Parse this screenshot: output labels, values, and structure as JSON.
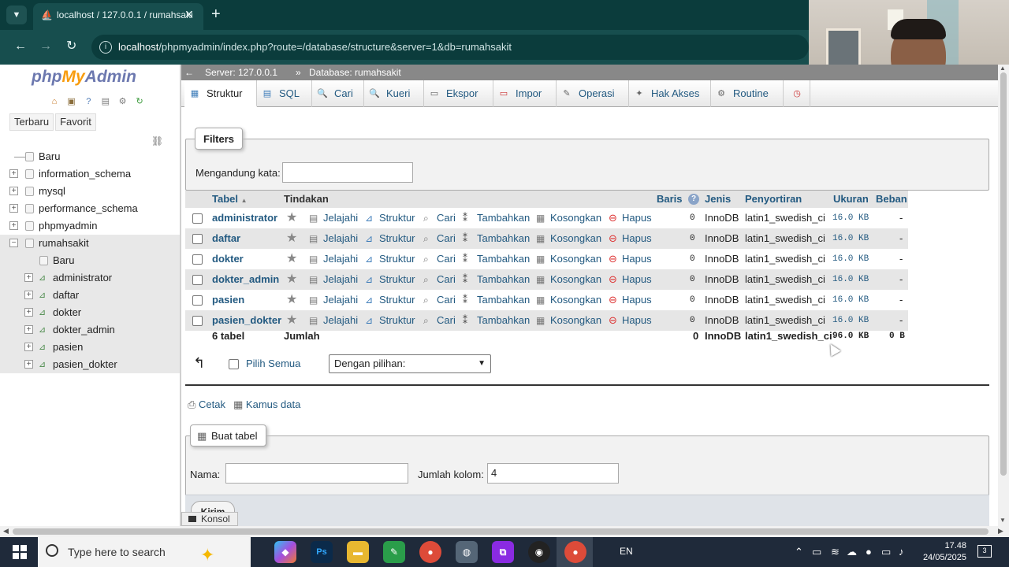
{
  "browser": {
    "tab_title": "localhost / 127.0.0.1 / rumahsaki",
    "tab_close": "✕",
    "tab_new": "+",
    "url_host": "localhost",
    "url_path": "/phpmyadmin/index.php?route=/database/structure&server=1&db=rumahsakit"
  },
  "sidebar": {
    "logo_php": "php",
    "logo_my": "My",
    "logo_admin": "Admin",
    "btn_recent": "Terbaru",
    "btn_favorites": "Favorit",
    "tree": [
      {
        "label": "Baru",
        "level": 0
      },
      {
        "label": "information_schema",
        "level": 0
      },
      {
        "label": "mysql",
        "level": 0
      },
      {
        "label": "performance_schema",
        "level": 0
      },
      {
        "label": "phpmyadmin",
        "level": 0
      },
      {
        "label": "rumahsakit",
        "level": 0,
        "selected": true
      },
      {
        "label": "Baru",
        "level": 1
      },
      {
        "label": "administrator",
        "level": 1
      },
      {
        "label": "daftar",
        "level": 1
      },
      {
        "label": "dokter",
        "level": 1
      },
      {
        "label": "dokter_admin",
        "level": 1
      },
      {
        "label": "pasien",
        "level": 1
      },
      {
        "label": "pasien_dokter",
        "level": 1
      }
    ]
  },
  "breadcrumb": {
    "server": "Server: 127.0.0.1",
    "separator": "»",
    "database": "Database: rumahsakit"
  },
  "menu": {
    "struktur": "Struktur",
    "sql": "SQL",
    "cari": "Cari",
    "kueri": "Kueri",
    "ekspor": "Ekspor",
    "impor": "Impor",
    "operasi": "Operasi",
    "hak_akses": "Hak Akses",
    "routine": "Routine"
  },
  "filters": {
    "legend": "Filters",
    "label": "Mengandung kata:",
    "value": ""
  },
  "table": {
    "headers": {
      "tabel": "Tabel",
      "tindakan": "Tindakan",
      "baris": "Baris",
      "jenis": "Jenis",
      "penyortiran": "Penyortiran",
      "ukuran": "Ukuran",
      "beban": "Beban"
    },
    "actions": {
      "jelajahi": "Jelajahi",
      "struktur": "Struktur",
      "cari": "Cari",
      "tambahkan": "Tambahkan",
      "kosongkan": "Kosongkan",
      "hapus": "Hapus"
    },
    "rows": [
      {
        "name": "administrator",
        "rows": "0",
        "engine": "InnoDB",
        "collation": "latin1_swedish_ci",
        "size": "16.0 KB",
        "overhead": "-"
      },
      {
        "name": "daftar",
        "rows": "0",
        "engine": "InnoDB",
        "collation": "latin1_swedish_ci",
        "size": "16.0 KB",
        "overhead": "-"
      },
      {
        "name": "dokter",
        "rows": "0",
        "engine": "InnoDB",
        "collation": "latin1_swedish_ci",
        "size": "16.0 KB",
        "overhead": "-"
      },
      {
        "name": "dokter_admin",
        "rows": "0",
        "engine": "InnoDB",
        "collation": "latin1_swedish_ci",
        "size": "16.0 KB",
        "overhead": "-"
      },
      {
        "name": "pasien",
        "rows": "0",
        "engine": "InnoDB",
        "collation": "latin1_swedish_ci",
        "size": "16.0 KB",
        "overhead": "-"
      },
      {
        "name": "pasien_dokter",
        "rows": "0",
        "engine": "InnoDB",
        "collation": "latin1_swedish_ci",
        "size": "16.0 KB",
        "overhead": "-"
      }
    ],
    "total": {
      "count": "6 tabel",
      "label": "Jumlah",
      "rows": "0",
      "engine": "InnoDB",
      "collation": "latin1_swedish_ci",
      "size": "96.0 KB",
      "overhead": "0 B"
    }
  },
  "bulk": {
    "select_all": "Pilih Semua",
    "with_selected": "Dengan pilihan:"
  },
  "links": {
    "print": "Cetak",
    "data_dict": "Kamus data"
  },
  "create_table": {
    "legend": "Buat tabel",
    "name_label": "Nama:",
    "name_value": "",
    "cols_label": "Jumlah kolom:",
    "cols_value": "4",
    "submit": "Kirim"
  },
  "console": {
    "label": "Konsol"
  },
  "taskbar": {
    "search_placeholder": "Type here to search",
    "lang": "EN",
    "time": "17.48",
    "date": "24/05/2025",
    "notifications": "3"
  }
}
